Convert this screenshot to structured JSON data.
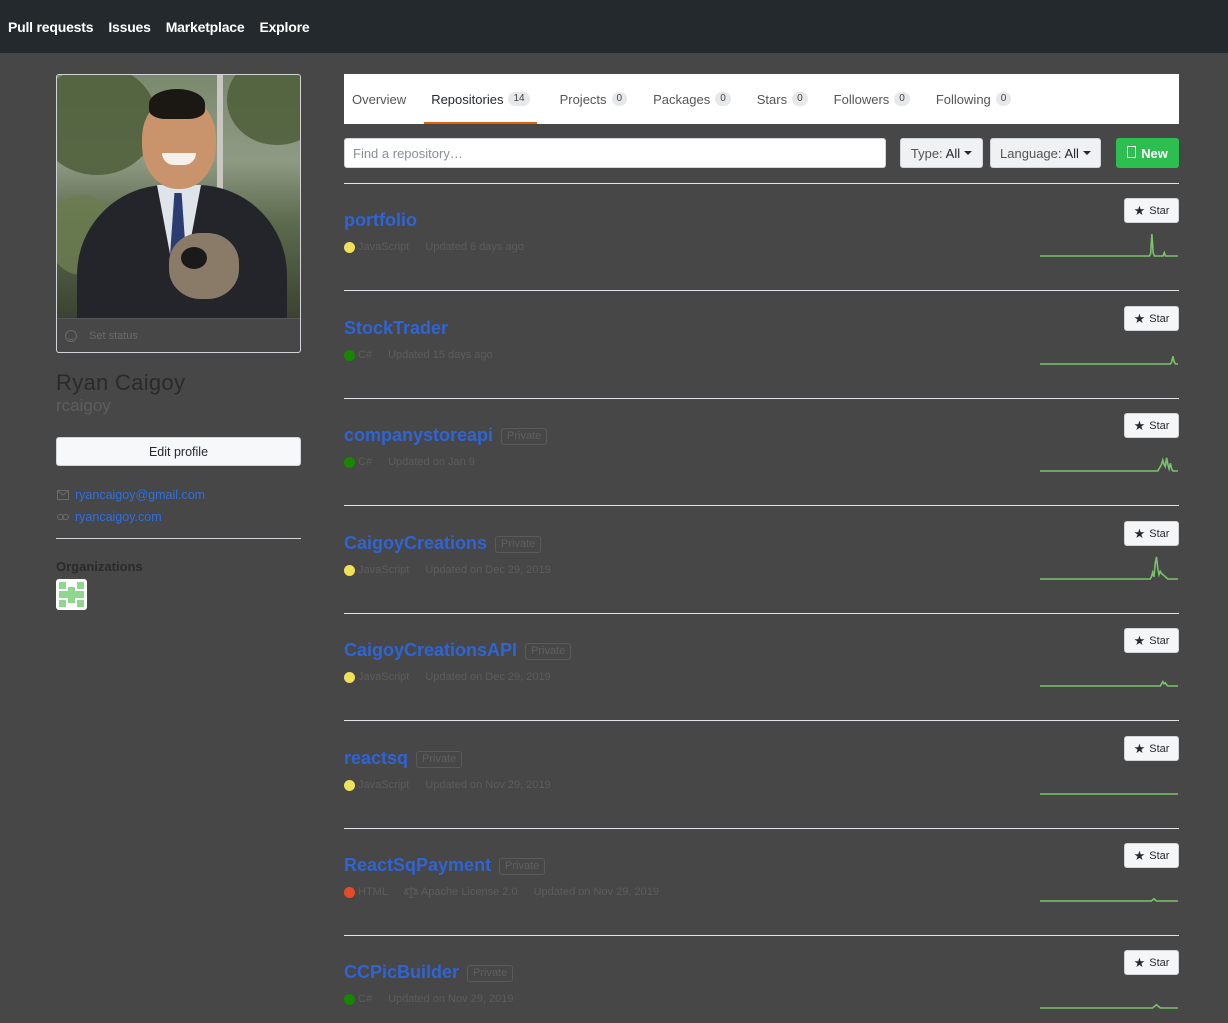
{
  "nav": {
    "items": [
      "Pull requests",
      "Issues",
      "Marketplace",
      "Explore"
    ]
  },
  "profile": {
    "status": "Set status",
    "fullname": "Ryan Caigoy",
    "username": "rcaigoy",
    "edit_label": "Edit profile",
    "email": "ryancaigoy@gmail.com",
    "website": "ryancaigoy.com",
    "organizations_title": "Organizations"
  },
  "tabs": [
    {
      "label": "Overview",
      "count": ""
    },
    {
      "label": "Repositories",
      "count": "14"
    },
    {
      "label": "Projects",
      "count": "0"
    },
    {
      "label": "Packages",
      "count": "0"
    },
    {
      "label": "Stars",
      "count": "0"
    },
    {
      "label": "Followers",
      "count": "0"
    },
    {
      "label": "Following",
      "count": "0"
    }
  ],
  "filters": {
    "search_placeholder": "Find a repository…",
    "type_label": "Type:",
    "type_value": "All",
    "language_label": "Language:",
    "language_value": "All",
    "new_label": "New"
  },
  "colors": {
    "accent_tab": "#e36209",
    "new_button": "#2cbe4e",
    "link": "#2f64d4",
    "javascript": "#f1e05a",
    "csharp": "#178600",
    "html": "#e34c26",
    "sparkline": "#7ac36a"
  },
  "repos": [
    {
      "name": "portfolio",
      "private": "",
      "language": "JavaScript",
      "lang_color": "#f1e05a",
      "license": "",
      "updated": "Updated 6 days ago",
      "star": "Star",
      "activity": [
        0,
        0,
        0,
        0,
        0,
        0,
        0,
        0,
        0,
        0,
        0,
        0,
        0,
        0,
        0,
        0,
        0,
        0,
        0,
        0,
        0,
        0,
        0,
        0,
        0,
        0,
        0,
        0,
        0,
        0,
        0,
        0,
        0,
        0,
        0,
        0,
        0,
        0,
        0,
        0,
        0,
        0,
        0,
        0,
        0,
        0,
        0,
        0,
        0,
        0,
        0,
        0,
        0,
        0,
        0,
        0,
        0,
        0,
        0,
        0,
        0,
        0,
        0,
        0,
        0,
        0,
        0,
        0,
        0,
        0,
        0,
        0,
        0,
        0,
        0,
        0,
        0,
        0,
        0,
        0,
        0,
        0,
        0,
        0,
        0,
        0,
        0,
        0,
        0,
        0.1,
        1,
        0.15,
        0,
        0,
        0,
        0,
        0,
        0,
        0,
        0,
        0.15,
        0,
        0,
        0,
        0,
        0,
        0,
        0,
        0,
        0,
        0,
        0
      ]
    },
    {
      "name": "StockTrader",
      "private": "",
      "language": "C#",
      "lang_color": "#178600",
      "license": "",
      "updated": "Updated 15 days ago",
      "star": "Star",
      "activity": [
        0,
        0,
        0,
        0,
        0,
        0,
        0,
        0,
        0,
        0,
        0,
        0,
        0,
        0,
        0,
        0,
        0,
        0,
        0,
        0,
        0,
        0,
        0,
        0,
        0,
        0,
        0,
        0,
        0,
        0,
        0,
        0,
        0,
        0,
        0,
        0,
        0,
        0,
        0,
        0,
        0,
        0,
        0,
        0,
        0,
        0,
        0,
        0,
        0,
        0,
        0,
        0,
        0,
        0,
        0,
        0,
        0,
        0,
        0,
        0,
        0,
        0,
        0,
        0,
        0,
        0,
        0,
        0,
        0,
        0,
        0,
        0,
        0,
        0,
        0,
        0,
        0,
        0,
        0,
        0,
        0,
        0,
        0,
        0,
        0,
        0,
        0,
        0,
        0,
        0,
        0,
        0,
        0,
        0,
        0,
        0,
        0,
        0,
        0,
        0,
        0,
        0,
        0,
        0,
        0.1,
        0.35,
        0.1,
        0,
        0,
        0
      ]
    },
    {
      "name": "companystoreapi",
      "private": "Private",
      "language": "C#",
      "lang_color": "#178600",
      "license": "",
      "updated": "Updated on Jan 9",
      "star": "Star",
      "activity": [
        0,
        0,
        0,
        0,
        0,
        0,
        0,
        0,
        0,
        0,
        0,
        0,
        0,
        0,
        0,
        0,
        0,
        0,
        0,
        0,
        0,
        0,
        0,
        0,
        0,
        0,
        0,
        0,
        0,
        0,
        0,
        0,
        0,
        0,
        0,
        0,
        0,
        0,
        0,
        0,
        0,
        0,
        0,
        0,
        0,
        0,
        0,
        0,
        0,
        0,
        0,
        0,
        0,
        0,
        0,
        0,
        0,
        0,
        0,
        0,
        0,
        0,
        0,
        0,
        0,
        0,
        0,
        0,
        0,
        0,
        0,
        0,
        0,
        0,
        0,
        0,
        0,
        0,
        0,
        0,
        0,
        0,
        0,
        0,
        0,
        0,
        0,
        0,
        0,
        0,
        0,
        0,
        0,
        0,
        0.1,
        0.2,
        0.3,
        0.5,
        0.3,
        0.2,
        0.6,
        0.3,
        0.1,
        0.35,
        0.1,
        0,
        0,
        0,
        0,
        0
      ]
    },
    {
      "name": "CaigoyCreations",
      "private": "Private",
      "language": "JavaScript",
      "lang_color": "#f1e05a",
      "license": "",
      "updated": "Updated on Dec 29, 2019",
      "star": "Star",
      "activity": [
        0,
        0,
        0,
        0,
        0,
        0,
        0,
        0,
        0,
        0,
        0,
        0,
        0,
        0,
        0,
        0,
        0,
        0,
        0,
        0,
        0,
        0,
        0,
        0,
        0,
        0,
        0,
        0,
        0,
        0,
        0,
        0,
        0,
        0,
        0,
        0,
        0,
        0,
        0,
        0,
        0,
        0,
        0,
        0,
        0,
        0,
        0,
        0,
        0,
        0,
        0,
        0,
        0,
        0,
        0,
        0,
        0,
        0,
        0,
        0,
        0,
        0,
        0,
        0,
        0,
        0,
        0,
        0,
        0,
        0,
        0,
        0,
        0,
        0,
        0,
        0,
        0,
        0,
        0,
        0,
        0,
        0,
        0,
        0,
        0,
        0,
        0,
        0,
        0.1,
        0.3,
        0.1,
        0.7,
        1,
        0.5,
        0.2,
        0.35,
        0.25,
        0.2,
        0.15,
        0.1,
        0.05,
        0,
        0,
        0,
        0,
        0,
        0,
        0,
        0,
        0
      ]
    },
    {
      "name": "CaigoyCreationsAPI",
      "private": "Private",
      "language": "JavaScript",
      "lang_color": "#f1e05a",
      "license": "",
      "updated": "Updated on Dec 29, 2019",
      "star": "Star",
      "activity": [
        0,
        0,
        0,
        0,
        0,
        0,
        0,
        0,
        0,
        0,
        0,
        0,
        0,
        0,
        0,
        0,
        0,
        0,
        0,
        0,
        0,
        0,
        0,
        0,
        0,
        0,
        0,
        0,
        0,
        0,
        0,
        0,
        0,
        0,
        0,
        0,
        0,
        0,
        0,
        0,
        0,
        0,
        0,
        0,
        0,
        0,
        0,
        0,
        0,
        0,
        0,
        0,
        0,
        0,
        0,
        0,
        0,
        0,
        0,
        0,
        0,
        0,
        0,
        0,
        0,
        0,
        0,
        0,
        0,
        0,
        0,
        0,
        0,
        0,
        0,
        0,
        0,
        0,
        0,
        0,
        0,
        0,
        0,
        0,
        0,
        0,
        0,
        0,
        0,
        0,
        0,
        0,
        0,
        0,
        0,
        0,
        0.1,
        0.2,
        0.1,
        0.15,
        0.05,
        0,
        0,
        0,
        0,
        0,
        0,
        0,
        0,
        0
      ]
    },
    {
      "name": "reactsq",
      "private": "Private",
      "language": "JavaScript",
      "lang_color": "#f1e05a",
      "license": "",
      "updated": "Updated on Nov 29, 2019",
      "star": "Star",
      "activity": [
        0,
        0,
        0,
        0,
        0,
        0,
        0,
        0,
        0,
        0,
        0,
        0,
        0,
        0,
        0,
        0,
        0,
        0,
        0,
        0,
        0,
        0,
        0,
        0,
        0,
        0,
        0,
        0,
        0,
        0,
        0,
        0,
        0,
        0,
        0,
        0,
        0,
        0,
        0,
        0,
        0,
        0,
        0,
        0,
        0,
        0,
        0,
        0,
        0,
        0,
        0,
        0,
        0,
        0,
        0,
        0,
        0,
        0,
        0,
        0,
        0,
        0,
        0,
        0,
        0,
        0,
        0,
        0,
        0,
        0,
        0,
        0,
        0,
        0,
        0,
        0,
        0,
        0,
        0,
        0,
        0,
        0,
        0,
        0,
        0,
        0,
        0,
        0,
        0,
        0,
        0,
        0,
        0,
        0,
        0,
        0,
        0,
        0,
        0,
        0,
        0,
        0,
        0,
        0,
        0,
        0,
        0,
        0,
        0,
        0
      ]
    },
    {
      "name": "ReactSqPayment",
      "private": "Private",
      "language": "HTML",
      "lang_color": "#e34c26",
      "license": "Apache License 2.0",
      "updated": "Updated on Nov 29, 2019",
      "star": "Star",
      "activity": [
        0,
        0,
        0,
        0,
        0,
        0,
        0,
        0,
        0,
        0,
        0,
        0,
        0,
        0,
        0,
        0,
        0,
        0,
        0,
        0,
        0,
        0,
        0,
        0,
        0,
        0,
        0,
        0,
        0,
        0,
        0,
        0,
        0,
        0,
        0,
        0,
        0,
        0,
        0,
        0,
        0,
        0,
        0,
        0,
        0,
        0,
        0,
        0,
        0,
        0,
        0,
        0,
        0,
        0,
        0,
        0,
        0,
        0,
        0,
        0,
        0,
        0,
        0,
        0,
        0,
        0,
        0,
        0,
        0,
        0,
        0,
        0,
        0,
        0,
        0,
        0,
        0,
        0,
        0,
        0,
        0,
        0,
        0,
        0,
        0,
        0,
        0,
        0,
        0,
        0.05,
        0.1,
        0.05,
        0,
        0,
        0,
        0,
        0,
        0,
        0,
        0,
        0,
        0,
        0,
        0,
        0,
        0,
        0,
        0,
        0,
        0
      ]
    },
    {
      "name": "CCPicBuilder",
      "private": "Private",
      "language": "C#",
      "lang_color": "#178600",
      "license": "",
      "updated": "Updated on Nov 29, 2019",
      "star": "Star",
      "activity": [
        0,
        0,
        0,
        0,
        0,
        0,
        0,
        0,
        0,
        0,
        0,
        0,
        0,
        0,
        0,
        0,
        0,
        0,
        0,
        0,
        0,
        0,
        0,
        0,
        0,
        0,
        0,
        0,
        0,
        0,
        0,
        0,
        0,
        0,
        0,
        0,
        0,
        0,
        0,
        0,
        0,
        0,
        0,
        0,
        0,
        0,
        0,
        0,
        0,
        0,
        0,
        0,
        0,
        0,
        0,
        0,
        0,
        0,
        0,
        0,
        0,
        0,
        0,
        0,
        0,
        0,
        0,
        0,
        0,
        0,
        0,
        0,
        0,
        0,
        0,
        0,
        0,
        0,
        0,
        0,
        0,
        0,
        0,
        0,
        0,
        0,
        0,
        0,
        0,
        0,
        0.05,
        0.1,
        0.15,
        0.1,
        0.05,
        0,
        0,
        0,
        0,
        0,
        0,
        0,
        0,
        0,
        0,
        0,
        0,
        0,
        0,
        0
      ]
    }
  ]
}
